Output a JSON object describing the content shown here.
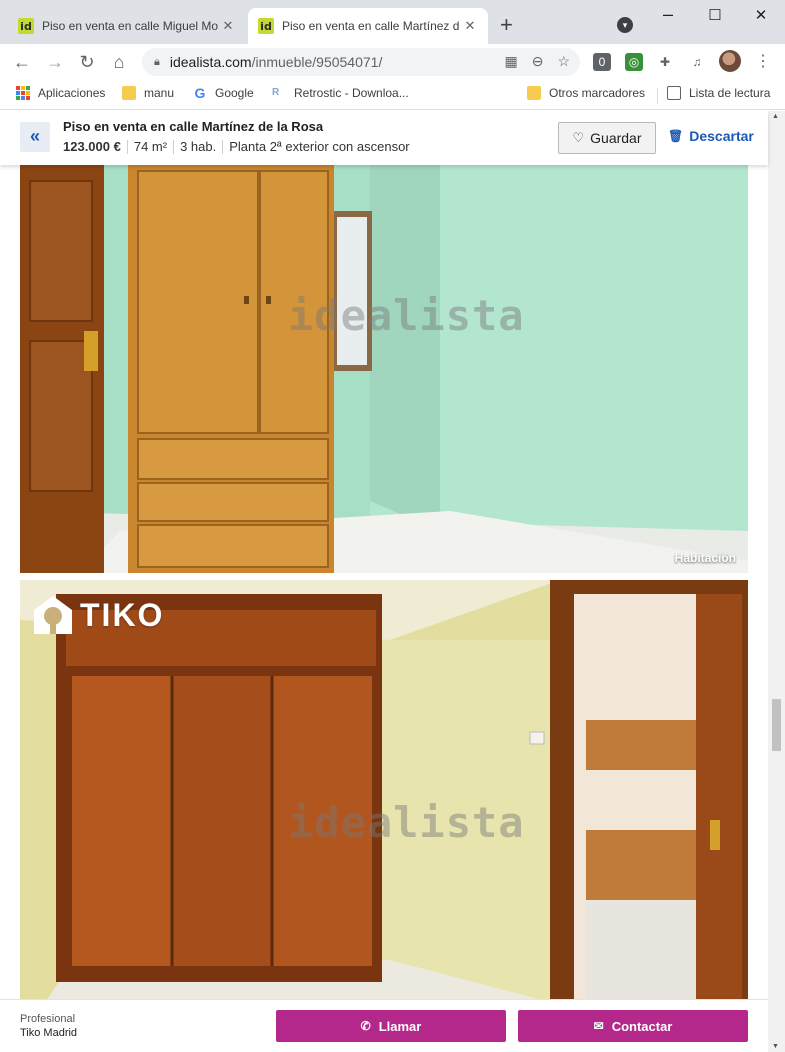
{
  "browser": {
    "tabs": [
      {
        "favicon": "id",
        "title": "Piso en venta en calle Miguel Mo",
        "active": false
      },
      {
        "favicon": "id",
        "title": "Piso en venta en calle Martínez d",
        "active": true
      }
    ],
    "new_tab": "+",
    "url_host": "idealista.com",
    "url_path": "/inmueble/95054071/",
    "bookmarks": [
      {
        "label": "Aplicaciones",
        "icon": "apps-grid-icon"
      },
      {
        "label": "manu",
        "icon": "folder-icon"
      },
      {
        "label": "Google",
        "icon": "google-icon"
      },
      {
        "label": "Retrostic - Downloa...",
        "icon": "retrostic-icon"
      },
      {
        "label": "Otros marcadores",
        "icon": "folder-icon"
      },
      {
        "label": "Lista de lectura",
        "icon": "reading-list-icon"
      }
    ]
  },
  "header": {
    "title": "Piso en venta en calle Martínez de la Rosa",
    "price": "123.000 €",
    "area": "74 m²",
    "rooms": "3 hab.",
    "floor": "Planta 2ª exterior con ascensor",
    "save_label": "Guardar",
    "discard_label": "Descartar"
  },
  "gallery": {
    "watermark": "idealista",
    "photos": [
      {
        "caption": "Habitación"
      },
      {
        "caption": "",
        "brand": "TIKO"
      }
    ]
  },
  "contact": {
    "advertiser_type": "Profesional",
    "advertiser_name": "Tiko Madrid",
    "call_label": "Llamar",
    "contact_label": "Contactar"
  },
  "colors": {
    "accent_blue": "#1e5ab4",
    "cta_magenta": "#b4288c",
    "favicon_green": "#c5d92f"
  }
}
